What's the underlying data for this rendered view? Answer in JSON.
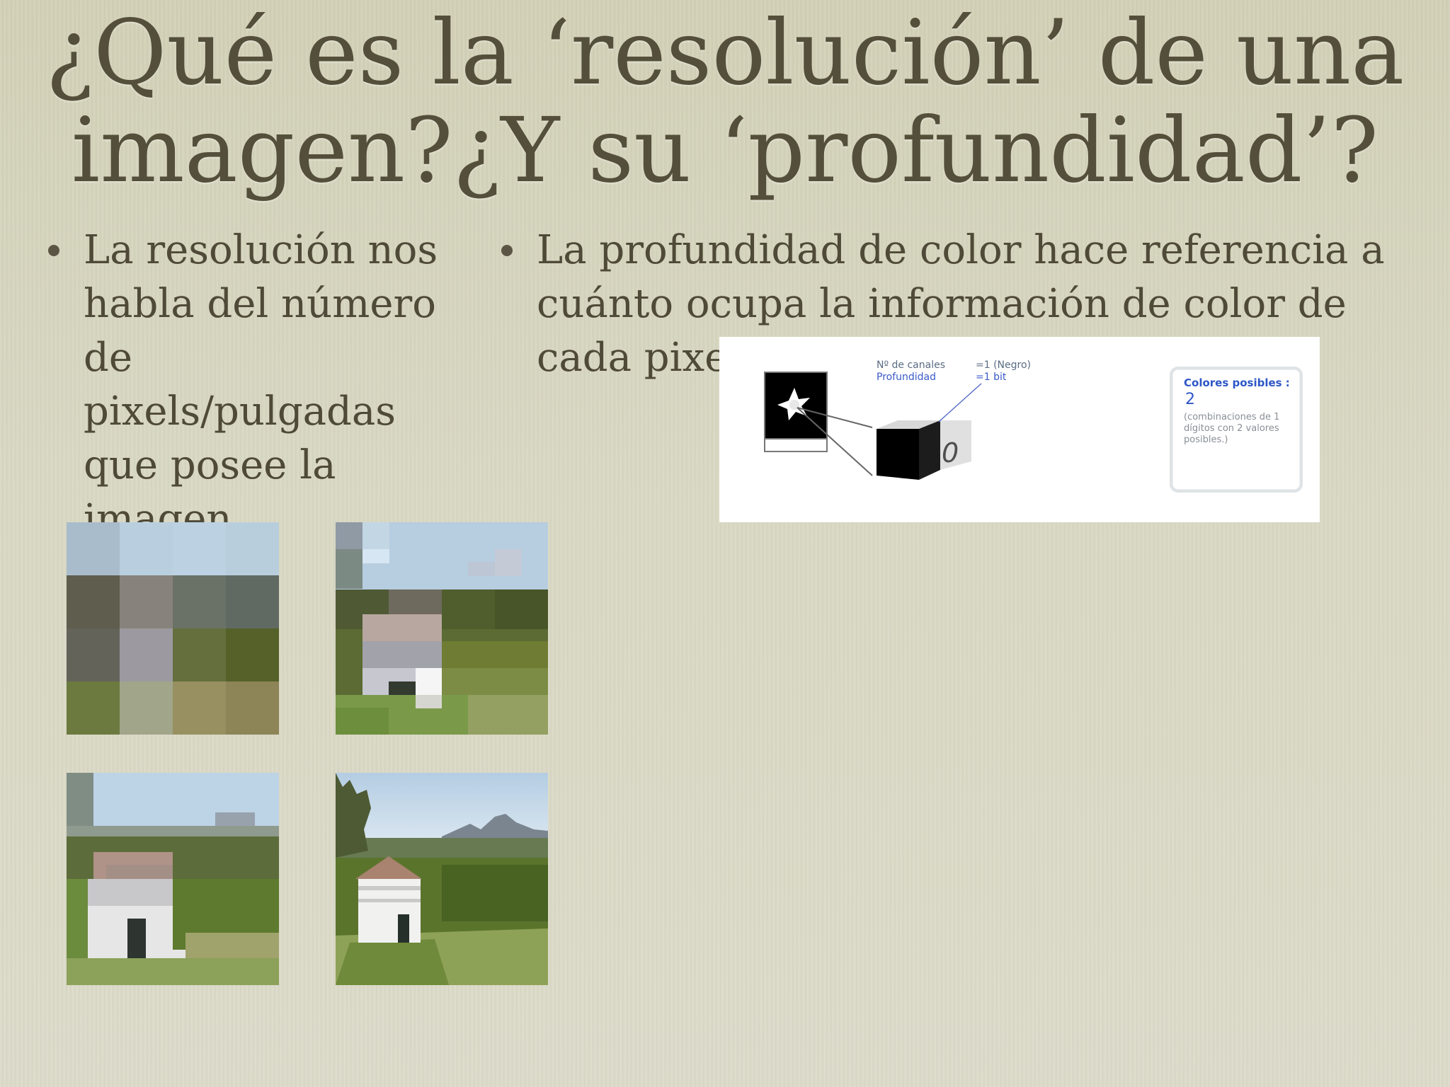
{
  "title": {
    "line1": "¿Qué es la ‘resolución’ de una",
    "line2": "imagen?¿Y su ‘profundidad’?"
  },
  "left_bullet": {
    "text": "La resolución nos\nhabla del número\nde pixels/pulgadas\nque posee la\nimagen."
  },
  "right_bullet": {
    "text": "La profundidad de color hace referencia a cuánto ocupa la información de color de cada pixel"
  },
  "depth_diagram": {
    "channels_label": "Nº de canales",
    "channels_value": "=1 (Negro)",
    "depth_label": "Profundidad",
    "depth_value": "=1 bit",
    "cube_value": "0",
    "colors_box": {
      "title": "Colores posibles :",
      "value": "2",
      "note": "(combinaciones de 1\ndígitos con 2 valores\nposibles.)"
    }
  },
  "thumbnails": [
    {
      "name": "4x4 pixel version"
    },
    {
      "name": "8x8 pixel version"
    },
    {
      "name": "16x16 pixel version"
    },
    {
      "name": "full resolution version"
    }
  ],
  "colors": {
    "background": "#d6d4bd",
    "title_text": "#544f3a",
    "body_text": "#4f4a38",
    "diagram_blue": "#2d57c6"
  }
}
